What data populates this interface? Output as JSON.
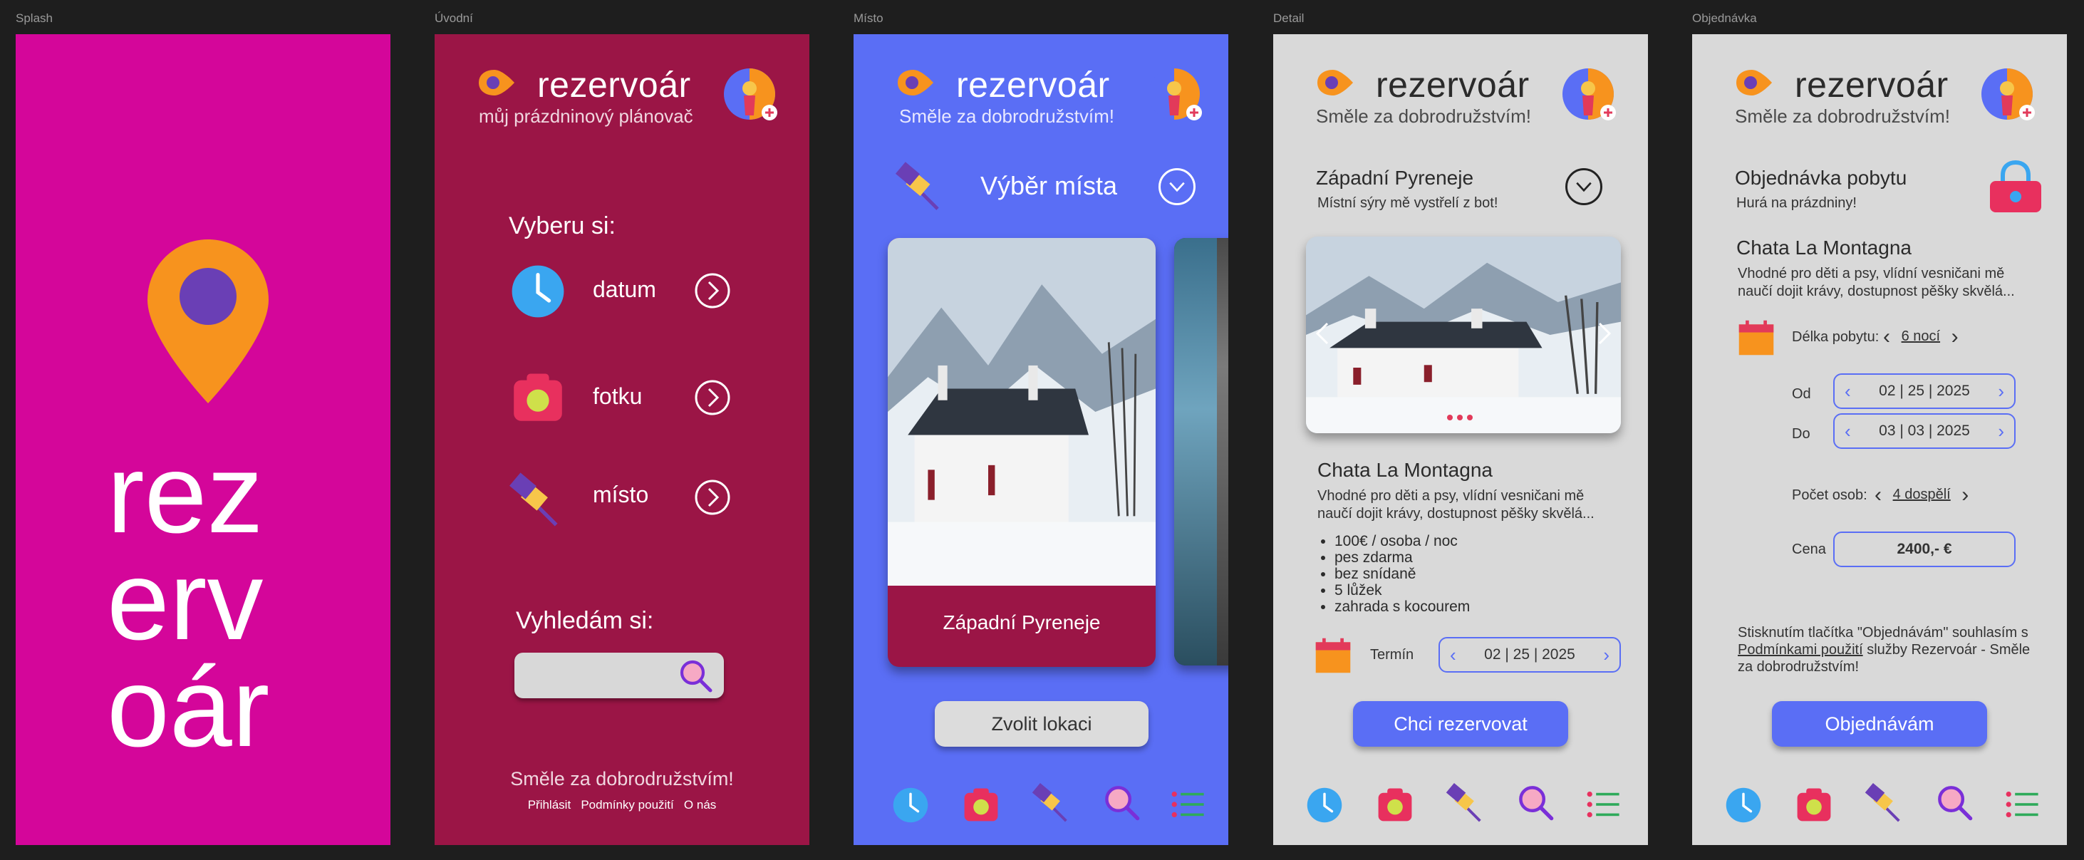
{
  "frames": {
    "splash": {
      "label": "Splash",
      "logo_text": [
        "rez",
        "erv",
        "oár"
      ]
    },
    "uvodni": {
      "label": "Úvodní",
      "brand": "rezervoár",
      "tagline": "můj prázdninový plánovač",
      "choose_heading": "Vyberu si:",
      "options": [
        "datum",
        "fotku",
        "místo"
      ],
      "search_heading": "Vyhledám si:",
      "footer_slogan": "Směle za dobrodružstvím!",
      "footer_links": [
        "Přihlásit",
        "Podmínky použití",
        "O nás"
      ]
    },
    "misto": {
      "label": "Místo",
      "brand": "rezervoár",
      "tagline": "Směle za dobrodružstvím!",
      "section_title": "Výběr místa",
      "card_caption": "Západní Pyreneje",
      "select_button": "Zvolit lokaci"
    },
    "detail": {
      "label": "Detail",
      "brand": "rezervoár",
      "tagline": "Směle za dobrodružstvím!",
      "location": "Západní Pyreneje",
      "location_sub": "Místní sýry mě vystřelí z bot!",
      "name": "Chata La Montagna",
      "description": "Vhodné pro děti a psy, vlídní vesničani mě naučí dojit krávy, dostupnost pěšky skvělá...",
      "features": [
        "100€ / osoba / noc",
        "pes zdarma",
        "bez snídaně",
        "5 lůžek",
        "zahrada s kocourem"
      ],
      "term_label": "Termín",
      "term_value": "02 | 25 | 2025",
      "book_button": "Chci rezervovat"
    },
    "objednavka": {
      "label": "Objednávka",
      "brand": "rezervoár",
      "tagline": "Směle za dobrodružstvím!",
      "title": "Objednávka pobytu",
      "subtitle": "Hurá na prázdniny!",
      "name": "Chata La Montagna",
      "description": "Vhodné pro děti a psy, vlídní vesničani mě naučí dojit krávy, dostupnost pěšky skvělá...",
      "length_label": "Délka pobytu:",
      "length_value": "6 nocí",
      "from_label": "Od",
      "from_value": "02 | 25 | 2025",
      "to_label": "Do",
      "to_value": "03 | 03 | 2025",
      "persons_label": "Počet osob:",
      "persons_value": "4 dospělí",
      "price_label": "Cena",
      "price_value": "2400,- €",
      "terms_text_1": "Stisknutím tlačítka \"Objednávám\" souhlasím s",
      "terms_link": "Podmínkami použití",
      "terms_text_2": "služby Rezervoár - Směle za dobrodružstvím!",
      "order_button": "Objednávám"
    }
  },
  "colors": {
    "background": "#1e1e1e",
    "splash": "#d4069a",
    "uvodni": "#9b1546",
    "misto": "#5a6ef5",
    "gray_frame": "#d9d9d9",
    "accent_orange": "#f7931e",
    "accent_purple": "#6a3fb5",
    "button_blue": "#5a6ef5"
  }
}
